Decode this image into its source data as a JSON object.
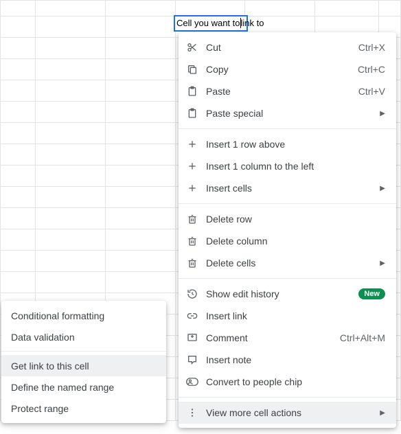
{
  "active_cell": {
    "value_before_cursor": "Cell you want to",
    "value_after_cursor": "link to"
  },
  "context_menu": {
    "cut": {
      "label": "Cut",
      "shortcut": "Ctrl+X"
    },
    "copy": {
      "label": "Copy",
      "shortcut": "Ctrl+C"
    },
    "paste": {
      "label": "Paste",
      "shortcut": "Ctrl+V"
    },
    "paste_special": {
      "label": "Paste special"
    },
    "insert_row": {
      "label": "Insert 1 row above"
    },
    "insert_col": {
      "label": "Insert 1 column to the left"
    },
    "insert_cells": {
      "label": "Insert cells"
    },
    "delete_row": {
      "label": "Delete row"
    },
    "delete_col": {
      "label": "Delete column"
    },
    "delete_cells": {
      "label": "Delete cells"
    },
    "show_history": {
      "label": "Show edit history",
      "badge": "New"
    },
    "insert_link": {
      "label": "Insert link"
    },
    "comment": {
      "label": "Comment",
      "shortcut": "Ctrl+Alt+M"
    },
    "insert_note": {
      "label": "Insert note"
    },
    "people_chip": {
      "label": "Convert to people chip"
    },
    "view_more": {
      "label": "View more cell actions"
    }
  },
  "submenu": {
    "cond_fmt": {
      "label": "Conditional formatting"
    },
    "data_val": {
      "label": "Data validation"
    },
    "get_link": {
      "label": "Get link to this cell"
    },
    "named_range": {
      "label": "Define the named range"
    },
    "protect": {
      "label": "Protect range"
    }
  }
}
